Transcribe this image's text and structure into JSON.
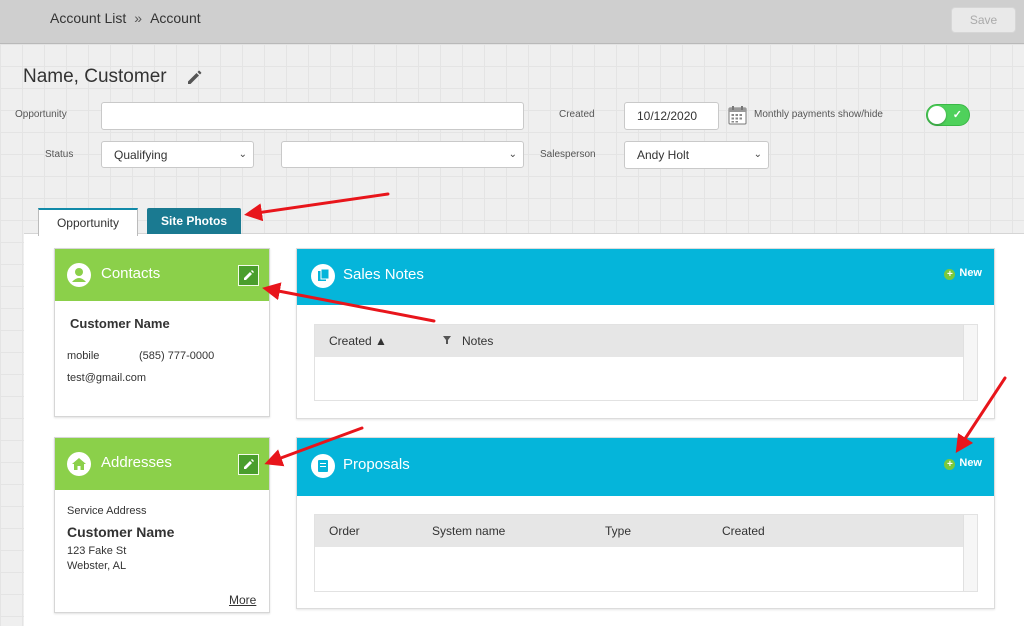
{
  "breadcrumb": {
    "parent": "Account List",
    "separator": "»",
    "current": "Account"
  },
  "toolbar": {
    "save_label": "Save"
  },
  "page_title": "Name, Customer",
  "form": {
    "opportunity_label": "Opportunity",
    "opportunity_value": "",
    "created_label": "Created",
    "created_value": "10/12/2020",
    "monthly_label": "Monthly payments show/hide",
    "status_label": "Status",
    "status_value": "Qualifying",
    "status2_value": "",
    "salesperson_label": "Salesperson",
    "salesperson_value": "Andy Holt",
    "toggle_on": true
  },
  "tabs": [
    {
      "label": "Opportunity",
      "active": true
    },
    {
      "label": "Site Photos",
      "active": false
    }
  ],
  "contacts": {
    "title": "Contacts",
    "name": "Customer Name",
    "phone_type": "mobile",
    "phone": "(585) 777-0000",
    "email": "test@gmail.com"
  },
  "addresses": {
    "title": "Addresses",
    "type": "Service Address",
    "name": "Customer Name",
    "street": "123 Fake St",
    "city": "Webster,  AL",
    "more": "More"
  },
  "sales_notes": {
    "title": "Sales Notes",
    "new_label": "New",
    "columns": [
      "Created ▲",
      "Notes"
    ]
  },
  "proposals": {
    "title": "Proposals",
    "new_label": "New",
    "columns": [
      "Order",
      "System name",
      "Type",
      "Created"
    ]
  },
  "colors": {
    "green_header": "#8bd04a",
    "blue_header": "#05b5da",
    "tab_active_bg": "#1a7a91",
    "annotation_arrow": "#e8151b"
  }
}
